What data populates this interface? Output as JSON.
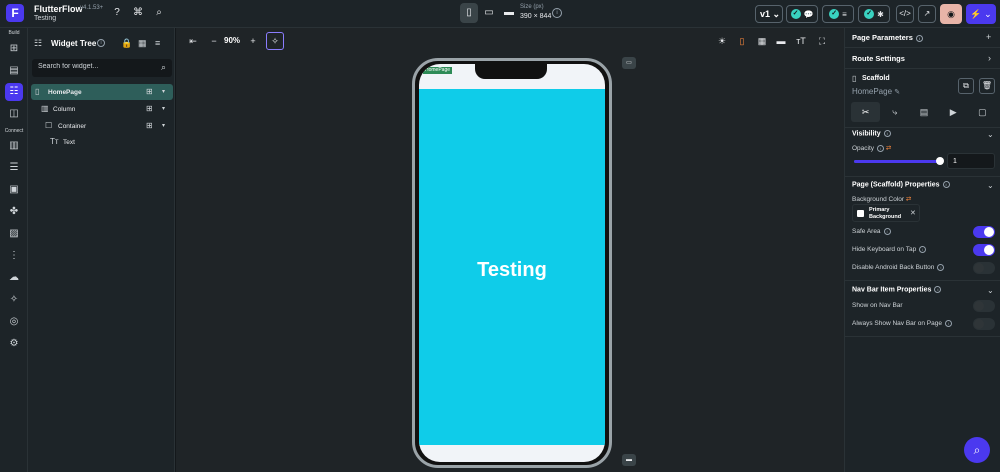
{
  "topbar": {
    "app_name": "FlutterFlow",
    "version": "v4.1.53+",
    "project_name": "Testing",
    "size_label": "Size (px)",
    "size_value": "390 × 844",
    "branch": "v1",
    "icons": [
      "help-icon",
      "command-icon",
      "search-icon"
    ]
  },
  "leftnav": {
    "build_label": "Build",
    "connect_label": "Connect"
  },
  "widget_tree": {
    "title": "Widget Tree",
    "search_placeholder": "Search for widget...",
    "nodes": [
      {
        "label": "HomePage",
        "icon": "phone-icon"
      },
      {
        "label": "Column",
        "icon": "column-icon"
      },
      {
        "label": "Container",
        "icon": "container-icon"
      },
      {
        "label": "Text",
        "icon": "text-icon"
      }
    ]
  },
  "canvas": {
    "zoom": "90%",
    "page_tag": "HomePage",
    "screen_text": "Testing",
    "screen_color": "#0fcce9",
    "background_color": "#f1f4f8"
  },
  "properties": {
    "page_parameters": "Page Parameters",
    "route_settings": "Route Settings",
    "widget_type": "Scaffold",
    "widget_name": "HomePage",
    "visibility_title": "Visibility",
    "opacity_label": "Opacity",
    "opacity_value": "1",
    "opacity_fraction": 1.0,
    "page_props_title": "Page (Scaffold) Properties",
    "background_color_label": "Background Color",
    "background_color_value": "Primary Background",
    "safe_area_label": "Safe Area",
    "safe_area_on": true,
    "hide_keyboard_label": "Hide Keyboard on Tap",
    "hide_keyboard_on": true,
    "disable_back_label": "Disable Android Back Button",
    "disable_back_on": false,
    "nav_bar_title": "Nav Bar Item Properties",
    "show_nav_label": "Show on Nav Bar",
    "show_nav_on": false,
    "always_show_label": "Always Show Nav Bar on Page",
    "always_show_on": false
  },
  "colors": {
    "accent": "#4b39ef",
    "teal": "#39d2c0"
  }
}
